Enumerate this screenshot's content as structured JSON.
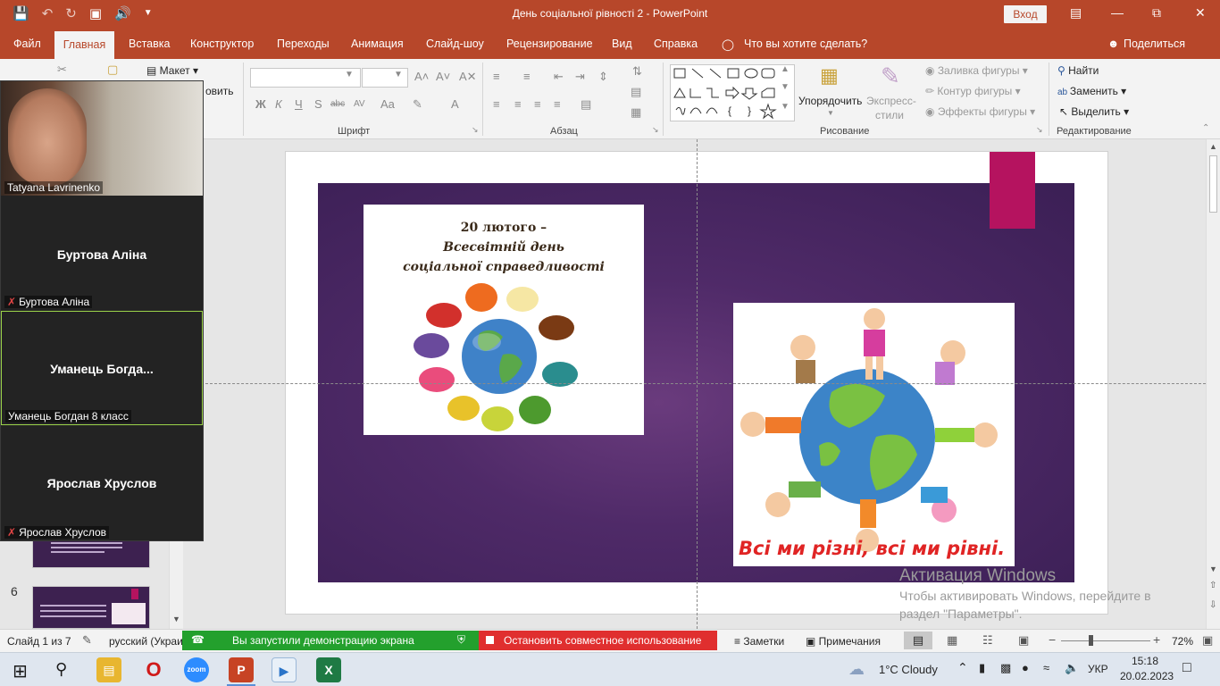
{
  "titlebar": {
    "title": "День соціальної рівності 2  -  PowerPoint",
    "login_label": "Вход"
  },
  "tabs": [
    {
      "label": "Файл"
    },
    {
      "label": "Главная"
    },
    {
      "label": "Вставка"
    },
    {
      "label": "Конструктор"
    },
    {
      "label": "Переходы"
    },
    {
      "label": "Анимация"
    },
    {
      "label": "Слайд-шоу"
    },
    {
      "label": "Рецензирование"
    },
    {
      "label": "Вид"
    },
    {
      "label": "Справка"
    }
  ],
  "tell_me": "Что вы хотите сделать?",
  "share_label": "Поделиться",
  "ribbon": {
    "layout_label": "Макет",
    "restore_label": "овить",
    "groups": {
      "font": "Шрифт",
      "paragraph": "Абзац",
      "drawing": "Рисование",
      "editing": "Редактирование"
    },
    "arrange_label": "Упорядочить",
    "quick_styles_line1": "Экспресс-",
    "quick_styles_line2": "стили",
    "shape_fill": "Заливка фигуры",
    "shape_outline": "Контур фигуры",
    "shape_effects": "Эффекты фигуры",
    "find": "Найти",
    "replace": "Заменить",
    "select": "Выделить",
    "bold": "Ж",
    "italic": "К",
    "underline": "Ч",
    "strike": "S",
    "abc": "abc",
    "av": "AV",
    "aa": "Aa"
  },
  "slide": {
    "poster_line1": "20 лютого –",
    "poster_line2": "Всесвітній день",
    "poster_line3": "соціальної справедливості",
    "kids_caption": "Всі ми різні, всі ми рівні."
  },
  "zoom": {
    "participants": [
      {
        "name_small": "Tatyana Lavrinenko",
        "muted": false,
        "video": true
      },
      {
        "name_big": "Буртова Аліна",
        "name_small": "Буртова Аліна",
        "muted": true
      },
      {
        "name_big": "Уманець  Богда...",
        "name_small": "Уманець Богдан 8 класс",
        "muted": false
      },
      {
        "name_big": "Ярослав Хруслов",
        "name_small": "Ярослав Хруслов",
        "muted": true
      }
    ]
  },
  "thumbs": {
    "slide6_number": "6"
  },
  "watermark": {
    "line1": "Активация Windows",
    "line2": "Чтобы активировать Windows, перейдите в раздел \"Параметры\"."
  },
  "statusbar": {
    "slide_counter": "Слайд 1 из 7",
    "language": "русский (Украи",
    "sharing_text": "Вы запустили демонстрацию экрана",
    "stop_text": "Остановить совместное использование",
    "notes": "Заметки",
    "comments": "Примечания",
    "zoom_pct": "72%"
  },
  "taskbar": {
    "weather": "1°C  Cloudy",
    "lang": "УКР",
    "time": "15:18",
    "date": "20.02.2023"
  }
}
